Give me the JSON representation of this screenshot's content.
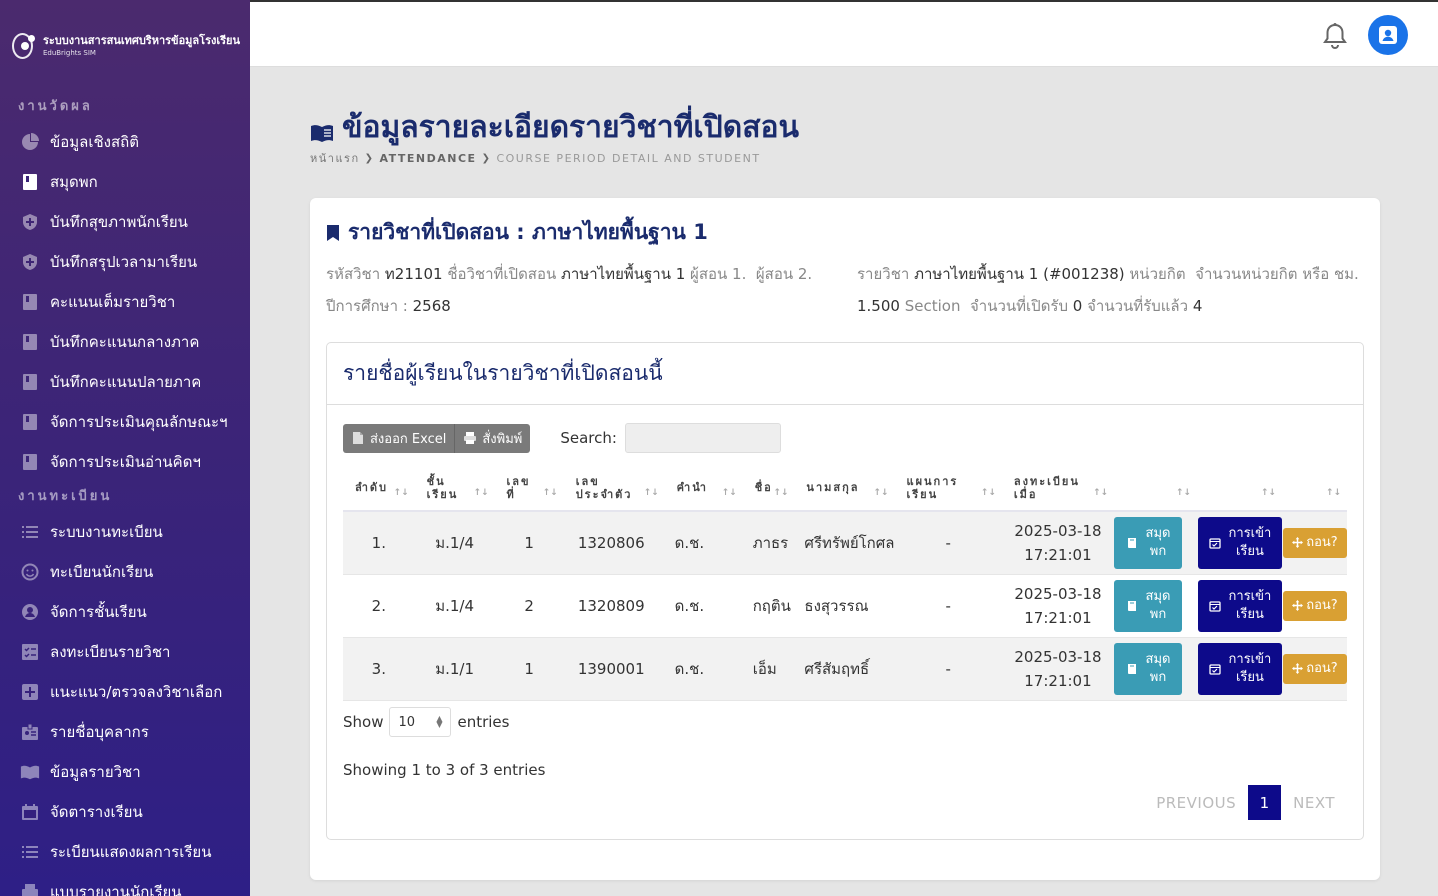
{
  "brand": {
    "title": "ระบบงานสารสนเทศบริหารข้อมูลโรงเรียน",
    "subtitle": "EduBrights SIM"
  },
  "sidebar": {
    "section1": "งานวัดผล",
    "section1_items": [
      {
        "label": "ข้อมูลเชิงสถิติ",
        "icon": "pie-chart-icon"
      },
      {
        "label": "สมุดพก",
        "icon": "book-icon",
        "active": true
      },
      {
        "label": "บันทึกสุขภาพนักเรียน",
        "icon": "shield-icon"
      },
      {
        "label": "บันทึกสรุปเวลามาเรียน",
        "icon": "shield-icon"
      },
      {
        "label": "คะแนนเต็มรายวิชา",
        "icon": "book-icon"
      },
      {
        "label": "บันทึกคะแนนกลางภาค",
        "icon": "book-icon"
      },
      {
        "label": "บันทึกคะแนนปลายภาค",
        "icon": "book-icon"
      },
      {
        "label": "จัดการประเมินคุณลักษณะฯ",
        "icon": "book-icon"
      },
      {
        "label": "จัดการประเมินอ่านคิดฯ",
        "icon": "book-icon"
      }
    ],
    "section2": "งานทะเบียน",
    "section2_items": [
      {
        "label": "ระบบงานทะเบียน",
        "icon": "list-icon"
      },
      {
        "label": "ทะเบียนนักเรียน",
        "icon": "smile-icon"
      },
      {
        "label": "จัดการชั้นเรียน",
        "icon": "user-circle-icon"
      },
      {
        "label": "ลงทะเบียนรายวิชา",
        "icon": "checklist-icon"
      },
      {
        "label": "แนะแนว/ตรวจลงวิชาเลือก",
        "icon": "plus-square-icon"
      },
      {
        "label": "รายชื่อบุคลากร",
        "icon": "id-badge-icon"
      },
      {
        "label": "ข้อมูลรายวิชา",
        "icon": "open-book-icon"
      },
      {
        "label": "จัดตารางเรียน",
        "icon": "calendar-icon"
      },
      {
        "label": "ระเบียนแสดงผลการเรียน",
        "icon": "list-icon"
      },
      {
        "label": "แบบรายงานนักเรียน",
        "icon": "printer-icon"
      }
    ]
  },
  "topbar": {
    "bell_icon": "bell-icon",
    "avatar_icon": "user-icon"
  },
  "page": {
    "title": "ข้อมูลรายละเอียดรายวิชาที่เปิดสอน",
    "breadcrumb": [
      "หน้าแรก",
      "ATTENDANCE",
      "COURSE PERIOD DETAIL AND STUDENT"
    ]
  },
  "course": {
    "title": "รายวิชาที่เปิดสอน : ภาษาไทยพื้นฐาน 1",
    "code_label": "รหัสวิชา",
    "code": "ท21101",
    "name_label": "ชื่อวิชาที่เปิดสอน",
    "name": "ภาษาไทยพื้นฐาน 1",
    "teacher1_label": "ผู้สอน 1.",
    "teacher2_label": "ผู้สอน 2.",
    "year_label": "ปีการศึกษา :",
    "year": "2568",
    "subject_label": "รายวิชา",
    "subject": "ภาษาไทยพื้นฐาน 1 (#001238)",
    "unit_label": "หน่วยกิต",
    "units_label": "จำนวนหน่วยกิต หรือ ชม.",
    "units": "1.500",
    "section_label": "Section",
    "open_label": "จำนวนที่เปิดรับ",
    "open": "0",
    "accepted_label": "จำนวนที่รับแล้ว",
    "accepted": "4"
  },
  "students": {
    "heading": "รายชื่อผู้เรียนในรายวิชาที่เปิดสอนนี้",
    "export_label": "ส่งออก Excel",
    "print_label": "สั่งพิมพ์",
    "search_label": "Search:",
    "columns": [
      "ลำดับ",
      "ชั้น เรียน",
      "เลข ที่",
      "เลข ประจำตัว",
      "คำนำ",
      "ชื่อ",
      "นามสกุล",
      "แผนการ เรียน",
      "ลงทะเบียน เมื่อ",
      "",
      "",
      ""
    ],
    "rows": [
      {
        "no": "1.",
        "class": "ม.1/4",
        "seat": "1",
        "id": "1320806",
        "prefix": "ด.ช.",
        "first": "ภาธร",
        "last": "ศรีทรัพย์โกศล",
        "plan": "-",
        "date": "2025-03-18",
        "time": "17:21:01"
      },
      {
        "no": "2.",
        "class": "ม.1/4",
        "seat": "2",
        "id": "1320809",
        "prefix": "ด.ช.",
        "first": "กฤติน",
        "last": "ธงสุวรรณ",
        "plan": "-",
        "date": "2025-03-18",
        "time": "17:21:01"
      },
      {
        "no": "3.",
        "class": "ม.1/1",
        "seat": "1",
        "id": "1390001",
        "prefix": "ด.ช.",
        "first": "เอ็ม",
        "last": "ศรีสัมฤทธิ์",
        "plan": "-",
        "date": "2025-03-18",
        "time": "17:21:01"
      }
    ],
    "btn_report_line1": "สมุด",
    "btn_report_line2": "พก",
    "btn_attend_line1": "การเข้า",
    "btn_attend_line2": "เรียน",
    "btn_withdraw": "ถอน?",
    "show_label": "Show",
    "entries_label": "entries",
    "page_size": "10",
    "showing": "Showing 1 to 3 of 3 entries",
    "prev": "PREVIOUS",
    "page": "1",
    "next": "NEXT"
  },
  "colors": {
    "sidebar_top": "#4b2a6e",
    "sidebar_bottom": "#2e1f86",
    "title": "#1a2b6d",
    "info_btn": "#3a9cb5",
    "nav_btn": "#0d0a8a",
    "warn_btn": "#d9a033",
    "avatar": "#1a73e8"
  }
}
